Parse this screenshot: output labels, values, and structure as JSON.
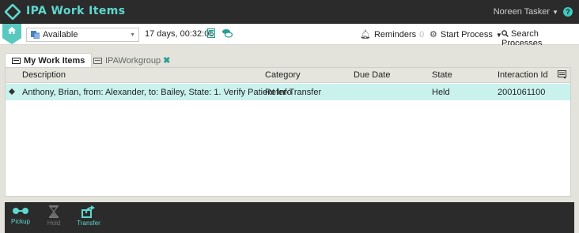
{
  "header": {
    "app_title": "IPA Work Items",
    "user_name": "Noreen Tasker",
    "help_label": "?"
  },
  "toolbar": {
    "status_value": "Available",
    "elapsed_time": "17 days, 00:32:06",
    "reminders_label": "Reminders",
    "reminders_count": "0",
    "start_process_label": "Start Process",
    "search_processes_label": "Search Processes"
  },
  "tabs": [
    {
      "label": "My Work Items",
      "active": true
    },
    {
      "label": "IPAWorkgroup",
      "active": false,
      "closable": true
    }
  ],
  "table": {
    "columns": [
      "Description",
      "Category",
      "Due Date",
      "State",
      "Interaction Id"
    ],
    "rows": [
      {
        "description": "Anthony, Brian, from: Alexander, to: Bailey, State: 1. Verify Patient Info",
        "category": "Refer-Transfer",
        "due_date": "",
        "state": "Held",
        "interaction_id": "2001061100"
      }
    ]
  },
  "actions": [
    {
      "label": "Pickup",
      "enabled": true,
      "icon": "pickup-icon"
    },
    {
      "label": "Hold",
      "enabled": false,
      "icon": "hourglass-icon"
    },
    {
      "label": "Transfer",
      "enabled": true,
      "icon": "transfer-icon"
    }
  ],
  "colors": {
    "accent": "#5fd8cf",
    "header_bg": "#2b2b2b",
    "selected_row": "#c9f2ee",
    "page_bg": "#e3e3dc"
  }
}
